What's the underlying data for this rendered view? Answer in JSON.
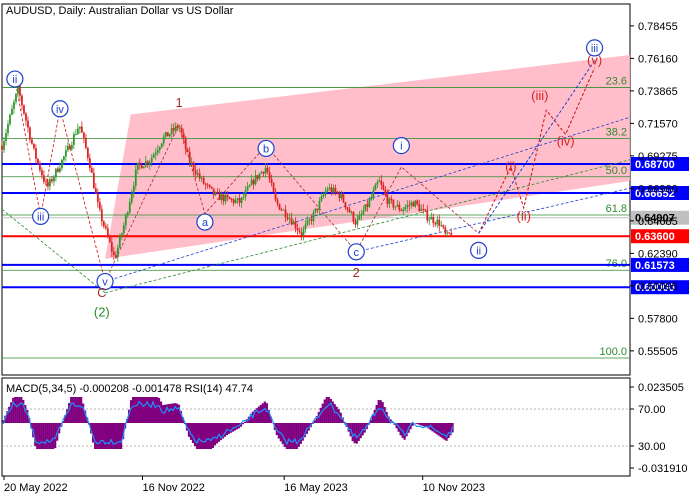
{
  "symbol": "AUDUSD",
  "timeframe": "Daily",
  "title": "AUDUSD, Daily:  Australian Dollar vs US Dollar",
  "colors": {
    "background": "#ffffff",
    "axis": "#000000",
    "fib": "#2e8b2e",
    "channel": "#ffb3c1",
    "blue_level": "#0000ff",
    "red_level": "#ff0000",
    "wave_red": "#cc1111",
    "wave_blue": "#1e3fcc",
    "wave_green": "#2a8a2a",
    "wave_brown": "#a0302a",
    "macd_fill": "#800080",
    "rsi_line": "#1e90ff",
    "bull": "#2e9a2e",
    "bear": "#dd2222"
  },
  "chart_data": [
    {
      "type": "candlestick",
      "x_axis": {
        "ticks": [
          "20 May 2022",
          "16 Nov 2022",
          "16 May 2023",
          "10 Nov 2023"
        ]
      },
      "y_axis": {
        "range": [
          0.538,
          0.8
        ],
        "ticks": [
          "0.78455",
          "0.76160",
          "0.73865",
          "0.71570",
          "0.69275",
          "0.66980",
          "0.64685",
          "0.62390",
          "0.60095",
          "0.57800",
          "0.55505"
        ]
      },
      "price_path": [
        {
          "t": 0.0,
          "p": 0.7
        },
        {
          "t": 0.05,
          "p": 0.74
        },
        {
          "t": 0.1,
          "p": 0.695
        },
        {
          "t": 0.14,
          "p": 0.67
        },
        {
          "t": 0.2,
          "p": 0.695
        },
        {
          "t": 0.24,
          "p": 0.715
        },
        {
          "t": 0.27,
          "p": 0.69
        },
        {
          "t": 0.3,
          "p": 0.655
        },
        {
          "t": 0.35,
          "p": 0.62
        },
        {
          "t": 0.38,
          "p": 0.645
        },
        {
          "t": 0.42,
          "p": 0.685
        },
        {
          "t": 0.46,
          "p": 0.69
        },
        {
          "t": 0.5,
          "p": 0.705
        },
        {
          "t": 0.55,
          "p": 0.714
        },
        {
          "t": 0.58,
          "p": 0.69
        },
        {
          "t": 0.62,
          "p": 0.675
        },
        {
          "t": 0.66,
          "p": 0.665
        },
        {
          "t": 0.7,
          "p": 0.662
        },
        {
          "t": 0.74,
          "p": 0.66
        },
        {
          "t": 0.78,
          "p": 0.675
        },
        {
          "t": 0.82,
          "p": 0.685
        },
        {
          "t": 0.85,
          "p": 0.66
        },
        {
          "t": 0.89,
          "p": 0.65
        },
        {
          "t": 0.93,
          "p": 0.638
        },
        {
          "t": 0.97,
          "p": 0.652
        },
        {
          "t": 1.01,
          "p": 0.67
        },
        {
          "t": 1.05,
          "p": 0.665
        },
        {
          "t": 1.1,
          "p": 0.645
        },
        {
          "t": 1.14,
          "p": 0.66
        },
        {
          "t": 1.17,
          "p": 0.675
        },
        {
          "t": 1.2,
          "p": 0.66
        },
        {
          "t": 1.24,
          "p": 0.655
        },
        {
          "t": 1.28,
          "p": 0.66
        },
        {
          "t": 1.32,
          "p": 0.65
        },
        {
          "t": 1.36,
          "p": 0.645
        },
        {
          "t": 1.38,
          "p": 0.635
        },
        {
          "t": 1.4,
          "p": 0.64
        }
      ],
      "horizontal_levels": [
        {
          "price": 0.687,
          "label": "0.68700",
          "color": "#0000ff",
          "style": "thick"
        },
        {
          "price": 0.66652,
          "label": "0.66652",
          "color": "#0000ff",
          "style": "thick"
        },
        {
          "price": 0.64907,
          "label": "0.64907",
          "color": "#c0c0c0",
          "style": "current"
        },
        {
          "price": 0.636,
          "label": "0.63600",
          "color": "#ff0000",
          "style": "thick"
        },
        {
          "price": 0.61573,
          "label": "0.61573",
          "color": "#0000ff",
          "style": "thick"
        },
        {
          "price": 0.6,
          "label": "0.60000",
          "color": "#0000ff",
          "style": "thick"
        }
      ],
      "fibonacci_levels": [
        {
          "label": "23.6",
          "price": 0.741
        },
        {
          "label": "38.2",
          "price": 0.705
        },
        {
          "label": "50.0",
          "price": 0.678
        },
        {
          "label": "61.8",
          "price": 0.651
        },
        {
          "label": "76.0",
          "price": 0.612
        },
        {
          "label": "100.0",
          "price": 0.55
        }
      ],
      "wave_labels": [
        {
          "text": "ii",
          "t": 0.04,
          "p": 0.747,
          "style": "circle",
          "color": "#1e3fcc"
        },
        {
          "text": "iii",
          "t": 0.12,
          "p": 0.65,
          "style": "circle",
          "color": "#1e3fcc"
        },
        {
          "text": "iv",
          "t": 0.18,
          "p": 0.726,
          "style": "circle",
          "color": "#1e3fcc"
        },
        {
          "text": "v",
          "t": 0.32,
          "p": 0.604,
          "style": "circle",
          "color": "#1e3fcc"
        },
        {
          "text": "C",
          "t": 0.31,
          "p": 0.596,
          "style": "plain",
          "color": "#a0302a"
        },
        {
          "text": "(2)",
          "t": 0.31,
          "p": 0.582,
          "style": "plain",
          "color": "#2a8a2a"
        },
        {
          "text": "1",
          "t": 0.55,
          "p": 0.73,
          "style": "plain",
          "color": "#a0302a"
        },
        {
          "text": "a",
          "t": 0.63,
          "p": 0.646,
          "style": "circle",
          "color": "#1e3fcc"
        },
        {
          "text": "b",
          "t": 0.82,
          "p": 0.698,
          "style": "circle",
          "color": "#1e3fcc"
        },
        {
          "text": "c",
          "t": 1.1,
          "p": 0.625,
          "style": "circle",
          "color": "#1e3fcc"
        },
        {
          "text": "2",
          "t": 1.1,
          "p": 0.61,
          "style": "plain",
          "color": "#a0302a"
        },
        {
          "text": "i",
          "t": 1.24,
          "p": 0.7,
          "style": "circle",
          "color": "#1e3fcc"
        },
        {
          "text": "ii",
          "t": 1.48,
          "p": 0.626,
          "style": "circle",
          "color": "#1e3fcc"
        },
        {
          "text": "(i)",
          "t": 1.58,
          "p": 0.685,
          "style": "plain",
          "color": "#dd2222"
        },
        {
          "text": "(ii)",
          "t": 1.62,
          "p": 0.65,
          "style": "plain",
          "color": "#dd2222"
        },
        {
          "text": "(iii)",
          "t": 1.67,
          "p": 0.735,
          "style": "plain",
          "color": "#dd2222"
        },
        {
          "text": "(iv)",
          "t": 1.75,
          "p": 0.703,
          "style": "plain",
          "color": "#dd2222"
        },
        {
          "text": "(v)",
          "t": 1.84,
          "p": 0.76,
          "style": "plain",
          "color": "#dd2222"
        },
        {
          "text": "iii",
          "t": 1.84,
          "p": 0.769,
          "style": "circle",
          "color": "#1e3fcc"
        }
      ],
      "projection": [
        {
          "t": 1.48,
          "p": 0.638
        },
        {
          "t": 1.58,
          "p": 0.685
        },
        {
          "t": 1.62,
          "p": 0.656
        },
        {
          "t": 1.69,
          "p": 0.725
        },
        {
          "t": 1.75,
          "p": 0.708
        },
        {
          "t": 1.84,
          "p": 0.755
        }
      ]
    },
    {
      "type": "indicator",
      "label": "MACD(5,34,5) -0.000208 -0.001478 RSI(14) 47.74",
      "y_axis_ticks": [
        "0.023505",
        "70.00",
        "30.00",
        "-0.031910"
      ]
    }
  ]
}
